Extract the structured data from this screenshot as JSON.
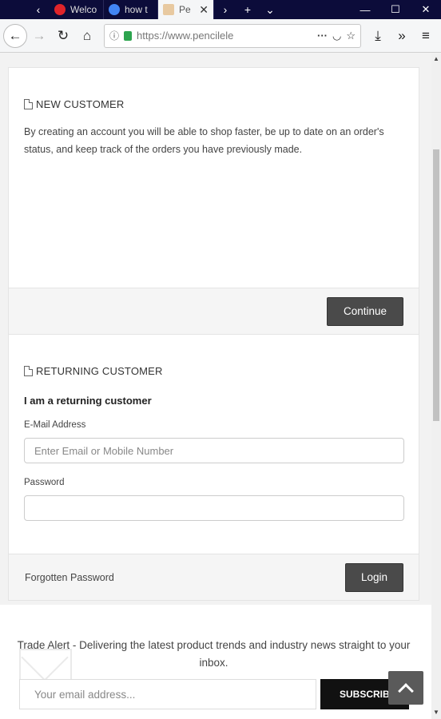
{
  "browser": {
    "tabs": [
      {
        "title": "Welco",
        "icon_color": "#e0242a"
      },
      {
        "title": "how t",
        "icon_color": "#4285f4"
      },
      {
        "title": "Pe",
        "icon_color": "#f5f6f7"
      }
    ],
    "url": "https://www.pencilele",
    "icons": [
      "back-icon",
      "forward-icon",
      "reload-icon",
      "home-icon",
      "info-icon",
      "lock-icon",
      "more-icon",
      "pocket-icon",
      "star-icon",
      "download-icon",
      "overflow-icon",
      "menu-icon"
    ]
  },
  "new_customer": {
    "heading": "NEW CUSTOMER",
    "text": "By creating an account you will be able to shop faster, be up to date on an order's status, and keep track of the orders you have previously made.",
    "continue_label": "Continue"
  },
  "returning_customer": {
    "heading": "RETURNING CUSTOMER",
    "subheading": "I am a returning customer",
    "email_label": "E-Mail Address",
    "email_placeholder": "Enter Email or Mobile Number",
    "password_label": "Password",
    "forgotten_label": "Forgotten Password",
    "login_label": "Login"
  },
  "newsletter": {
    "text": "Trade Alert - Delivering the latest product trends and industry news straight to your inbox.",
    "placeholder": "Your email address...",
    "subscribe_label": "SUBSCRIBE"
  },
  "colors": {
    "button_dark": "#4a4a4a",
    "titlebar": "#0c0c3a",
    "lock": "#2da44e"
  }
}
